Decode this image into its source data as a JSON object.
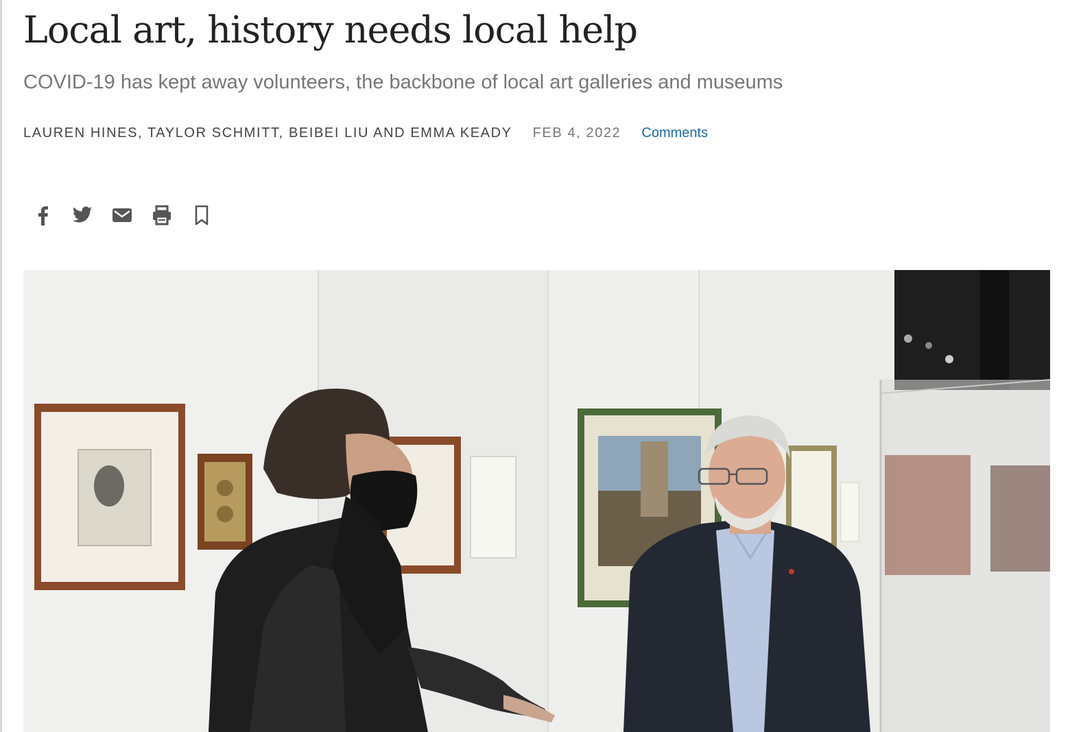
{
  "article": {
    "headline": "Local art, history needs local help",
    "subheadline": "COVID-19 has kept away volunteers, the backbone of local art galleries and museums",
    "byline": "LAUREN HINES, TAYLOR SCHMITT, BEIBEI LIU AND EMMA KEADY",
    "date": "FEB 4, 2022",
    "comments_label": "Comments"
  },
  "share_bar": {
    "icons": [
      "facebook-icon",
      "twitter-icon",
      "email-icon",
      "print-icon",
      "bookmark-icon"
    ]
  },
  "colors": {
    "headline": "#222222",
    "subheadline": "#777777",
    "byline": "#444444",
    "comments_link": "#1a6aa0",
    "icon": "#555555"
  }
}
